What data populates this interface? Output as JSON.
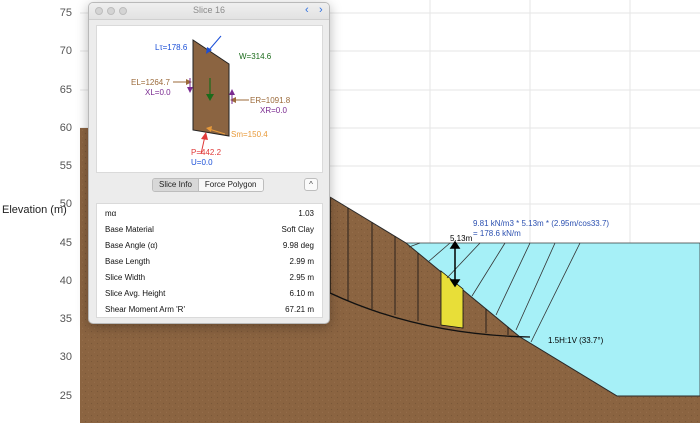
{
  "chart": {
    "y_axis_label": "Elevation (m)",
    "y_ticks": [
      "75",
      "70",
      "65",
      "60",
      "55",
      "50",
      "45",
      "40",
      "35",
      "30",
      "25"
    ],
    "formula_line1": "9.81 kN/m3 * 5.13m * (2.95m/cos33.7)",
    "formula_line2": "=  178.6 kN/m",
    "height_label": "5.13m",
    "slope_label": "1.5H:1V (33.7°)",
    "colors": {
      "soil": "#8b6441",
      "water": "#a6f0f7",
      "highlight_slice": "#e8de38"
    }
  },
  "dialog": {
    "title": "Slice 16",
    "prev_icon": "chevron-left-icon",
    "next_icon": "chevron-right-icon",
    "forces": {
      "lt": "Lτ=178.6",
      "w": "W=314.6",
      "el": "EL=1264.7",
      "xl": "XL=0.0",
      "er": "ER=1091.8",
      "xr": "XR=0.0",
      "sm": "Sm=150.4",
      "p": "P=442.2",
      "u": "U=0.0"
    },
    "tabs": [
      {
        "label": "Slice Info",
        "selected": true
      },
      {
        "label": "Force Polygon",
        "selected": false
      }
    ],
    "collapse_icon": "chevron-up-icon",
    "rows": [
      {
        "key": "mα",
        "value": "1.03"
      },
      {
        "key": "Base Material",
        "value": "Soft Clay"
      },
      {
        "key": "Base Angle (α)",
        "value": "9.98 deg"
      },
      {
        "key": "Base Length",
        "value": "2.99 m"
      },
      {
        "key": "Slice Width",
        "value": "2.95 m"
      },
      {
        "key": "Slice Avg. Height",
        "value": "6.10 m"
      },
      {
        "key": "Shear Moment Arm 'R'",
        "value": "67.21 m"
      }
    ]
  }
}
